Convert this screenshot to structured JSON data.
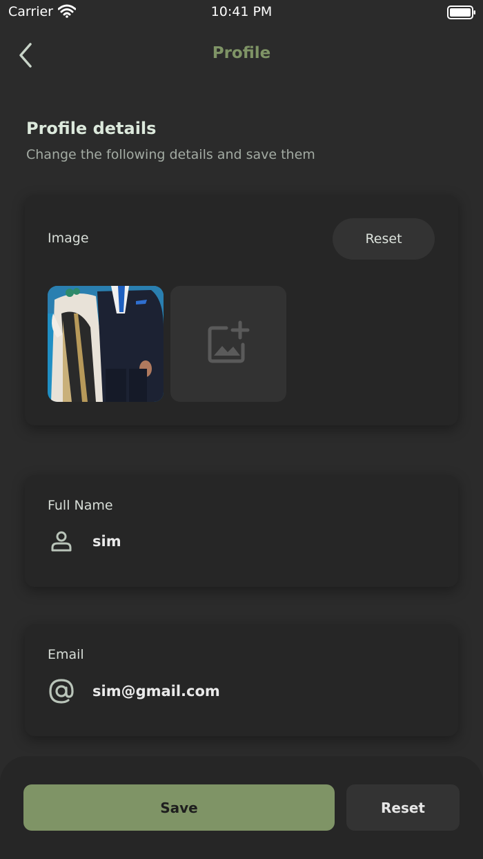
{
  "status_bar": {
    "carrier": "Carrier",
    "time": "10:41 PM"
  },
  "nav": {
    "title": "Profile",
    "back_icon": "chevron-left-icon"
  },
  "section": {
    "title": "Profile details",
    "subtitle": "Change the following details and save them"
  },
  "image_card": {
    "label": "Image",
    "reset_label": "Reset",
    "add_icon": "add-photo-icon"
  },
  "full_name": {
    "label": "Full Name",
    "value": "sim",
    "icon": "person-icon"
  },
  "email": {
    "label": "Email",
    "value": "sim@gmail.com",
    "icon": "at-icon"
  },
  "actions": {
    "save_label": "Save",
    "reset_label": "Reset"
  },
  "colors": {
    "accent": "#7f9466",
    "background": "#2b2b2b",
    "card": "#262626",
    "button_dark": "#333333"
  }
}
